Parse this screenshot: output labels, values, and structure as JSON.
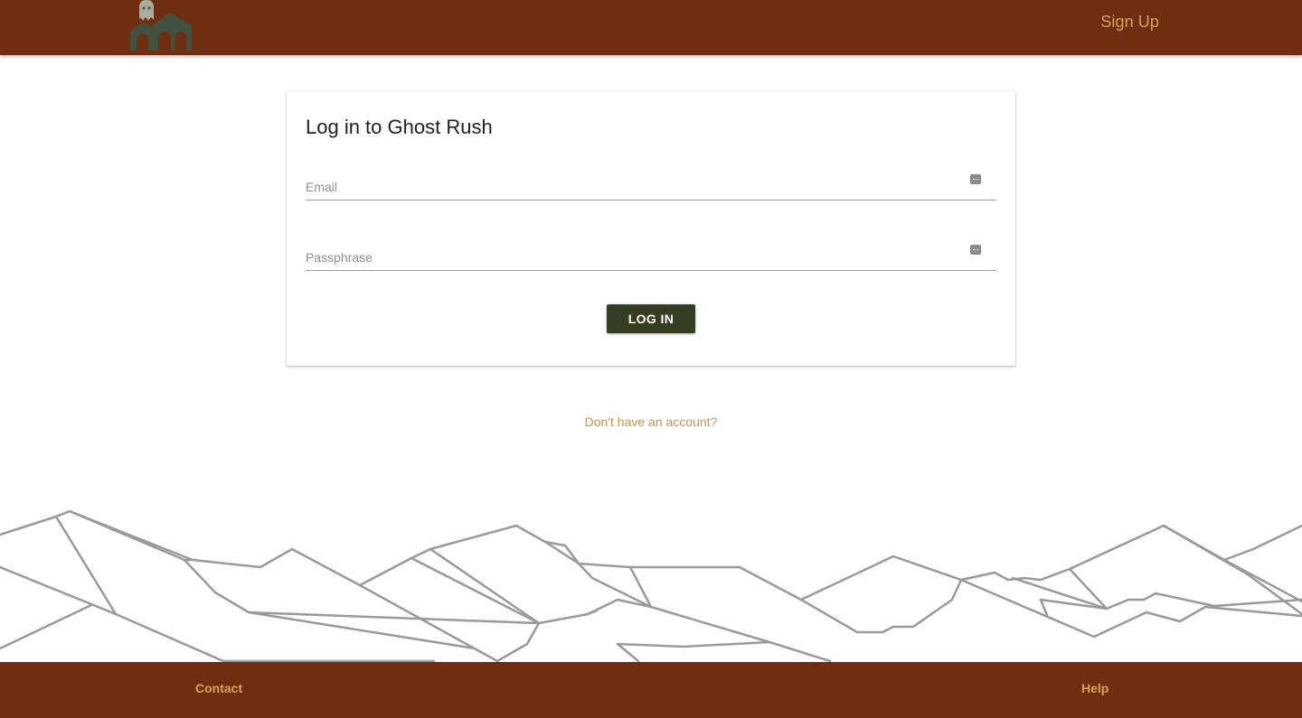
{
  "header": {
    "logo_icon": "ghost-house-logo-icon",
    "signup_label": "Sign Up"
  },
  "login_card": {
    "title": "Log in to Ghost Rush",
    "email": {
      "placeholder": "Email",
      "value": "",
      "icon": "password-manager-key-icon"
    },
    "passphrase": {
      "placeholder": "Passphrase",
      "value": "",
      "icon": "password-manager-key-icon"
    },
    "submit_label": "LOG IN"
  },
  "account_link": "Don't have an account?",
  "footer": {
    "contact_label": "Contact",
    "help_label": "Help"
  },
  "colors": {
    "header_bg": "#702e10",
    "link_gold": "#d7a257",
    "button_bg": "#363e22",
    "mountain_line": "#9a9a9a"
  }
}
